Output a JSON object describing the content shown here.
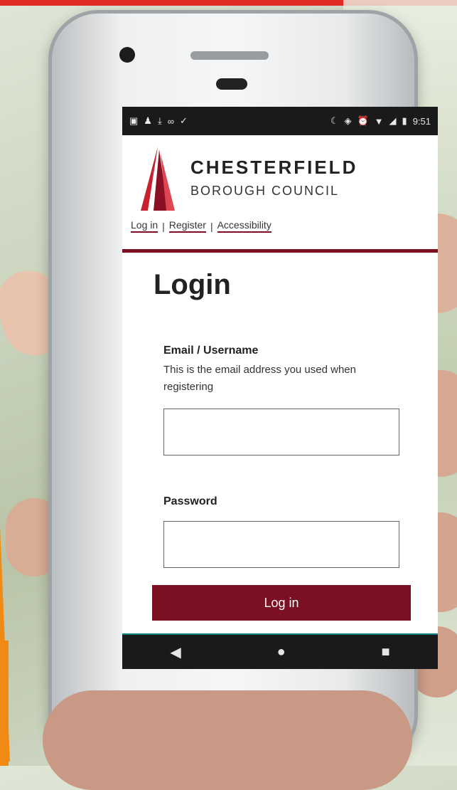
{
  "status_bar": {
    "left_icons": [
      "notification-icon",
      "person-icon",
      "download-icon",
      "voicemail-icon",
      "check-icon"
    ],
    "right_icons": [
      "battery-saver-icon",
      "vibrate-icon",
      "alarm-icon",
      "wifi-icon",
      "signal-icon",
      "battery-icon"
    ],
    "time": "9:51"
  },
  "header": {
    "org_name": "CHESTERFIELD",
    "org_subtitle": "BOROUGH COUNCIL",
    "nav": {
      "login": "Log in",
      "separator": "|",
      "register": "Register",
      "accessibility": "Accessibility"
    }
  },
  "page": {
    "title": "Login",
    "email_label": "Email / Username",
    "email_help": "This is the email address you used when registering",
    "email_value": "",
    "password_label": "Password",
    "password_value": "",
    "submit_label": "Log in"
  },
  "android_nav": {
    "back": "◀",
    "home": "●",
    "recent": "■"
  },
  "colors": {
    "brand": "#7a1022",
    "banner": "#e32b26",
    "accent_orange": "#f08a14"
  }
}
